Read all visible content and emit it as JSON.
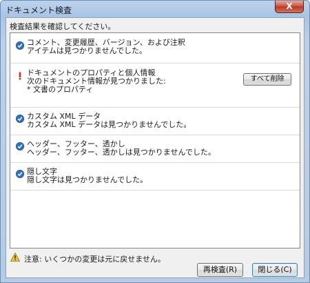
{
  "window": {
    "title": "ドキュメント検査",
    "close_label": "X"
  },
  "instruction": "検査結果を確認してください。",
  "results": [
    {
      "status": "ok",
      "lines": [
        "コメント、変更履歴、バージョン、および注釈",
        "アイテムは見つかりませんでした。"
      ]
    },
    {
      "status": "warning",
      "lines": [
        "ドキュメントのプロパティと個人情報",
        "次のドキュメント情報が見つかりました:",
        "* 文書のプロパティ"
      ],
      "action_label": "すべて削除"
    },
    {
      "status": "ok",
      "lines": [
        "カスタム XML データ",
        "カスタム XML データは見つかりませんでした。"
      ]
    },
    {
      "status": "ok",
      "lines": [
        "ヘッダー、フッター、透かし",
        "ヘッダー、フッター、透かしは見つかりませんでした。"
      ]
    },
    {
      "status": "ok",
      "lines": [
        "隠し文字",
        "隠し文字は見つかりませんでした。"
      ]
    }
  ],
  "note": "注意: いくつかの変更は元に戻せません。",
  "buttons": {
    "reinspect": "再検査(R)",
    "close": "閉じる(C)"
  },
  "colors": {
    "check": "#2f6fc4",
    "warning": "#d03a1a",
    "note_icon": "#f2c230"
  }
}
